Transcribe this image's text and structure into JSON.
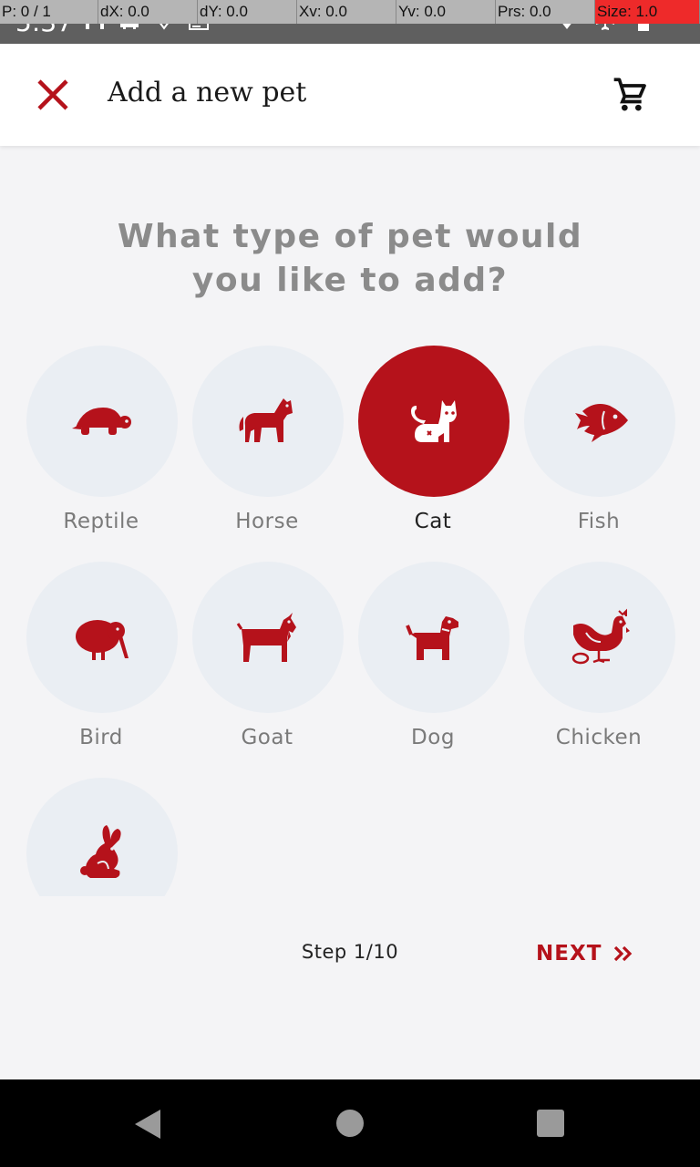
{
  "statusbar": {
    "time": "5:37",
    "overlay": {
      "p": "P: 0 / 1",
      "dx": "dX: 0.0",
      "dy": "dY: 0.0",
      "xv": "Xv: 0.0",
      "yv": "Yv: 0.0",
      "prs": "Prs: 0.0",
      "size": "Size: 1.0"
    },
    "left_icons": [
      "gmail-icon",
      "car-icon",
      "location-icon",
      "news-icon"
    ],
    "right_icons": [
      "wifi-icon",
      "airplane-icon",
      "battery-icon"
    ]
  },
  "appbar": {
    "title": "Add a new pet",
    "close_icon": "close-icon",
    "cart_icon": "cart-icon"
  },
  "question": {
    "line1": "What type of pet would",
    "line2": "you like to add?"
  },
  "pets": [
    {
      "label": "Reptile",
      "icon": "turtle-icon",
      "selected": false
    },
    {
      "label": "Horse",
      "icon": "horse-icon",
      "selected": false
    },
    {
      "label": "Cat",
      "icon": "cat-icon",
      "selected": true
    },
    {
      "label": "Fish",
      "icon": "fish-icon",
      "selected": false
    },
    {
      "label": "Bird",
      "icon": "kiwi-bird-icon",
      "selected": false
    },
    {
      "label": "Goat",
      "icon": "goat-icon",
      "selected": false
    },
    {
      "label": "Dog",
      "icon": "dog-icon",
      "selected": false
    },
    {
      "label": "Chicken",
      "icon": "chicken-icon",
      "selected": false
    },
    {
      "label": "",
      "icon": "rabbit-icon",
      "selected": false
    }
  ],
  "footer": {
    "step": "Step 1/10",
    "next_label": "NEXT",
    "next_icon": "double-chevron-right-icon"
  },
  "colors": {
    "accent": "#b5121b",
    "circle_bg": "#eaeef3",
    "page_bg": "#f4f4f6",
    "label_gray": "#7a7a7a",
    "question_gray": "#8b8b8b"
  },
  "navbar": {
    "icons": [
      "back-icon",
      "home-icon",
      "recents-icon"
    ]
  }
}
